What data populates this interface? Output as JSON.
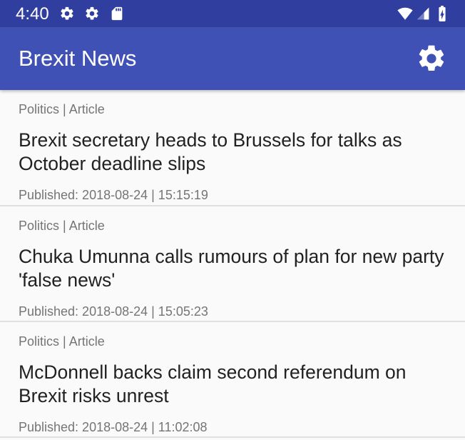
{
  "status_bar": {
    "time": "4:40",
    "left_icons": [
      "gear-icon",
      "gear-icon",
      "sd-card-icon"
    ],
    "right_icons": [
      "wifi-icon",
      "signal-icon",
      "battery-charging-icon"
    ]
  },
  "app_bar": {
    "title": "Brexit News",
    "settings_icon": "gear-icon"
  },
  "articles": [
    {
      "meta": "Politics | Article",
      "title": "Brexit secretary heads to Brussels for talks as October deadline slips",
      "published": "Published: 2018-08-24 | 15:15:19"
    },
    {
      "meta": "Politics | Article",
      "title": "Chuka Umunna calls rumours of plan for new party 'false news'",
      "published": "Published: 2018-08-24 | 15:05:23"
    },
    {
      "meta": "Politics | Article",
      "title": "McDonnell backs claim second referendum on Brexit risks unrest",
      "published": "Published: 2018-08-24 | 11:02:08"
    }
  ],
  "colors": {
    "status_bar": "#303f9f",
    "app_bar": "#3f51b5",
    "background": "#fafafa",
    "meta_text": "#757575",
    "title_text": "#212121"
  }
}
